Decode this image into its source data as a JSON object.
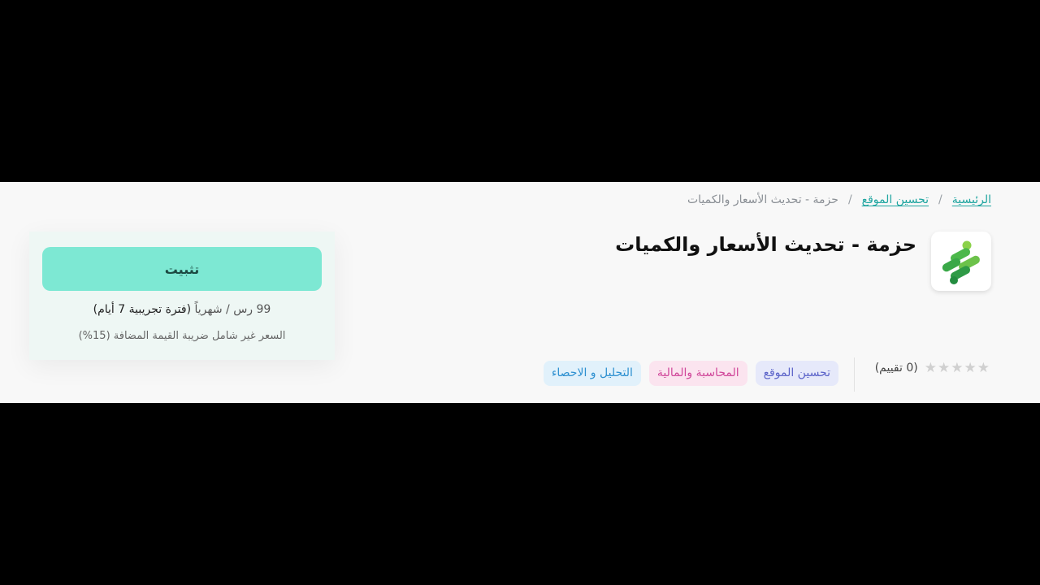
{
  "breadcrumb": {
    "home": "الرئيسية",
    "category": "تحسين الموقع",
    "current": "حزمة - تحديث الأسعار والكميات"
  },
  "app": {
    "title": "حزمة - تحديث الأسعار والكميات",
    "logo_icon": "app-logo-icon",
    "logo_colors": [
      "#2fa34a",
      "#8bd14a"
    ]
  },
  "rating": {
    "stars": 5,
    "count_label": "(0 تقييم)"
  },
  "tags": [
    {
      "label": "تحسين الموقع",
      "color": "#5b63c9"
    },
    {
      "label": "المحاسبة والمالية",
      "color": "#d0479a"
    },
    {
      "label": "التحليل و الاحصاء",
      "color": "#2b8fd0"
    }
  ],
  "purchase": {
    "install_label": "تثبيت",
    "price_amount": "99 رس / شهرياً",
    "trial_label": "(فترة تجريبية 7 أيام)",
    "vat_note": "السعر غير شامل ضريبة القيمة المضافة (15%)",
    "accent_color": "#7de8d3"
  }
}
